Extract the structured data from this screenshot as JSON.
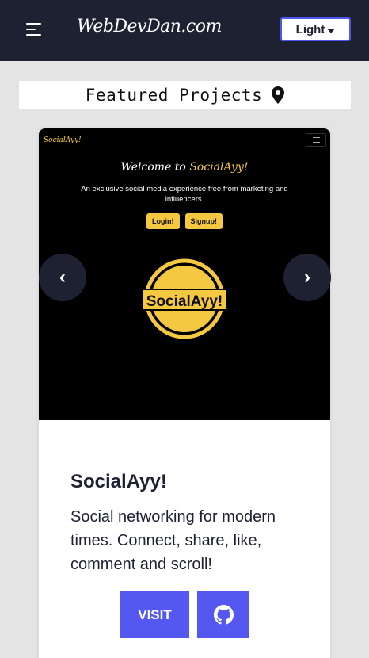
{
  "header": {
    "brand": "WebDevDan.com",
    "theme_select": {
      "selected": "Light"
    },
    "menu_icon": "hamburger-menu-icon"
  },
  "section": {
    "title": "Featured Projects",
    "icon": "map-pin-icon"
  },
  "project": {
    "preview": {
      "logo": "SocialAyy!",
      "welcome": "Welcome to",
      "welcome_accent": "SocialAyy!",
      "description": "An exclusive social media experience free from marketing and influencers.",
      "login_label": "Login!",
      "signup_label": "Signup!",
      "emblem_text": "SocialAyy!",
      "accent_color": "#f5c842"
    },
    "title": "SocialAyy!",
    "description": "Social networking for modern times. Connect, share, like, comment and scroll!",
    "visit_label": "VISIT",
    "github_icon": "github-icon"
  },
  "carousel": {
    "prev_label": "‹",
    "next_label": "›"
  },
  "colors": {
    "navbar": "#1e2132",
    "accent": "#5458f0",
    "background": "#e4e4e4"
  }
}
